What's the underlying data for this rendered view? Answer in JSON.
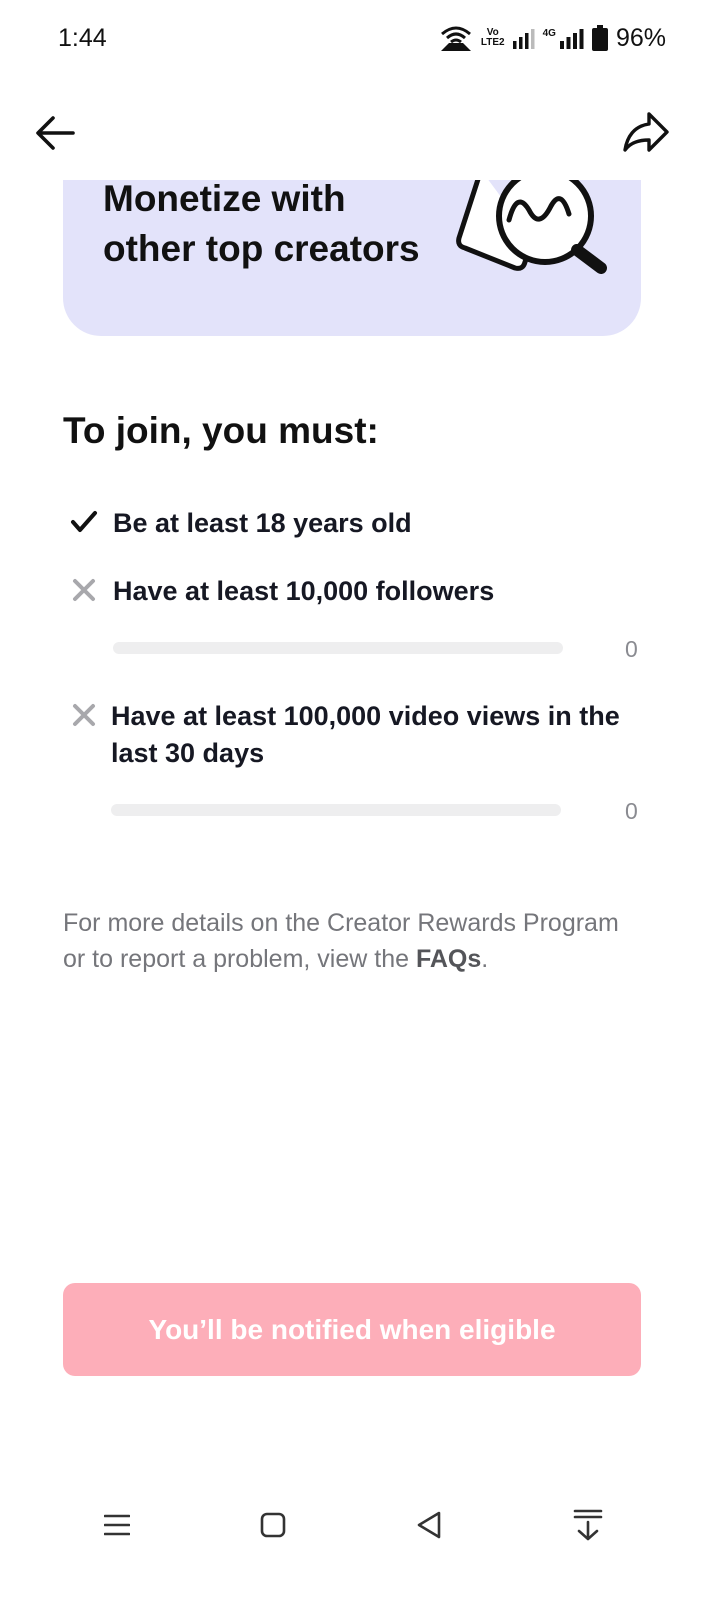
{
  "status_bar": {
    "time": "1:44",
    "network_badge_line1": "Vo",
    "network_badge_line2": "LTE2",
    "network_type": "4G",
    "battery_percent": "96%",
    "icons": [
      "wifi-hotspot-icon",
      "signal-icon",
      "signal-icon",
      "battery-icon"
    ]
  },
  "nav": {
    "back_icon": "arrow-left-icon",
    "share_icon": "share-arrow-icon"
  },
  "banner": {
    "title": "Monetize with other top creators",
    "illustration": "magnifier-chart-icon",
    "background": "#e3e3fa"
  },
  "requirements": {
    "heading": "To join, you must:",
    "items": [
      {
        "text": "Be at least 18 years old",
        "status": "met",
        "icon": "check-icon"
      },
      {
        "text": "Have at least 10,000 followers",
        "status": "not-met",
        "icon": "cross-icon",
        "progress_value": "0",
        "progress_fraction": 0
      },
      {
        "text": "Have at least 100,000 video views in the last 30 days",
        "status": "not-met",
        "icon": "cross-icon",
        "progress_value": "0",
        "progress_fraction": 0
      }
    ]
  },
  "details": {
    "text_before": "For more details on the Creator Rewards Program or to report a problem, view the ",
    "link_text": "FAQs",
    "text_after": "."
  },
  "cta": {
    "label": "You’ll be notified when eligible",
    "disabled": true,
    "color": "#fdaeb9"
  },
  "system_nav": {
    "icons": [
      "menu-icon",
      "home-square-icon",
      "back-triangle-icon",
      "notification-pull-icon"
    ]
  },
  "colors": {
    "accent": "#fe2c55",
    "text_primary": "#161823",
    "text_secondary": "#75767b",
    "cross_gray": "#a8a8ac"
  }
}
